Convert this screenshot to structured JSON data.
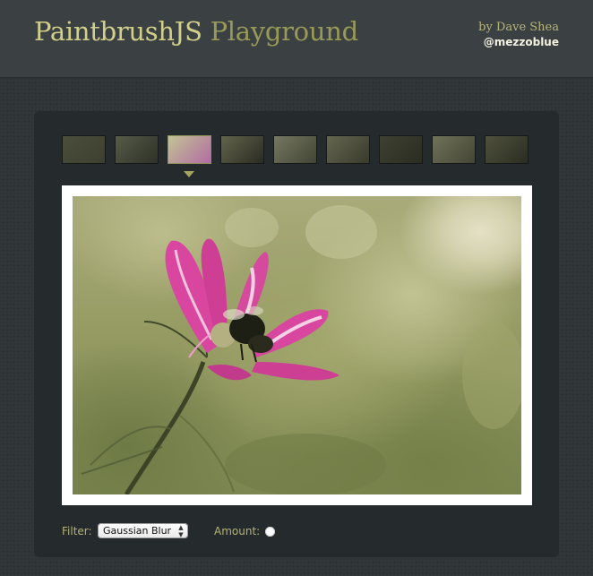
{
  "header": {
    "title_primary": "PaintbrushJS",
    "title_secondary": " Playground",
    "byline": "by Dave Shea",
    "handle": "@mezzoblue"
  },
  "gallery": {
    "selected_index": 2,
    "thumbnails": [
      {
        "name": "thumbnail-1",
        "colors": [
          "#6a6e4a",
          "#54583a"
        ]
      },
      {
        "name": "thumbnail-2",
        "colors": [
          "#77805a",
          "#3e4430"
        ]
      },
      {
        "name": "thumbnail-3",
        "colors": [
          "#c2c494",
          "#b26ca3"
        ]
      },
      {
        "name": "thumbnail-4",
        "colors": [
          "#8a8c5c",
          "#3a3d2a"
        ]
      },
      {
        "name": "thumbnail-5",
        "colors": [
          "#a3a878",
          "#5a6040"
        ]
      },
      {
        "name": "thumbnail-6",
        "colors": [
          "#8d8f62",
          "#4e5234"
        ]
      },
      {
        "name": "thumbnail-7",
        "colors": [
          "#575b3c",
          "#3a3e29"
        ]
      },
      {
        "name": "thumbnail-8",
        "colors": [
          "#9b9f6c",
          "#5e6240"
        ]
      },
      {
        "name": "thumbnail-9",
        "colors": [
          "#6e7248",
          "#3b3f2a"
        ]
      }
    ]
  },
  "controls": {
    "filter_label": "Filter:",
    "filter_value": "Gaussian Blur",
    "filter_chevron": "▲▼",
    "amount_label": "Amount:",
    "amount_value": 0
  },
  "colors": {
    "accent": "#d1cf88",
    "petal": "#d8469f",
    "selection_arrow": "#a7a660"
  }
}
